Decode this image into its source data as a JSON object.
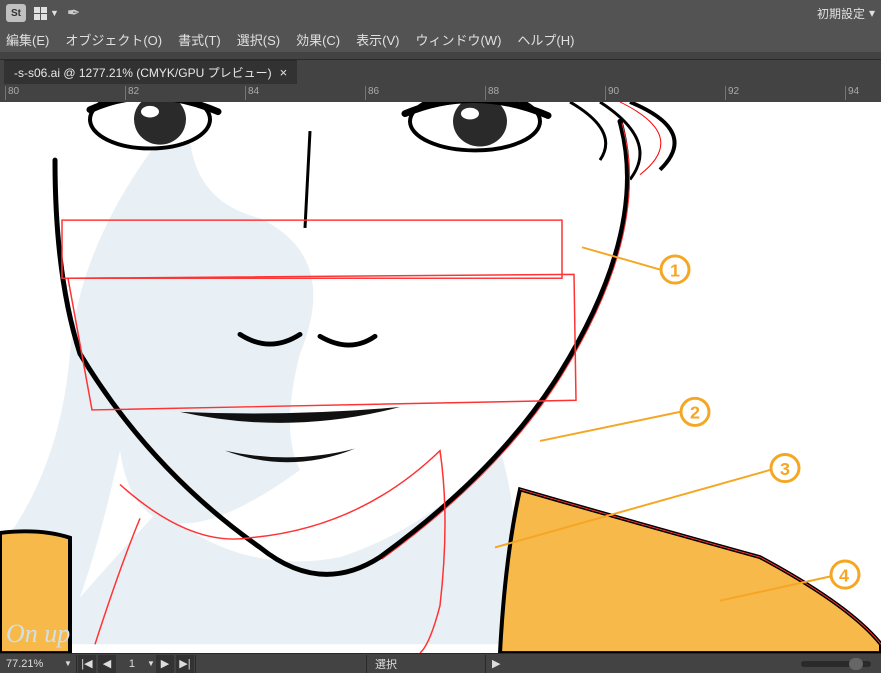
{
  "appbar": {
    "stock_badge": "St",
    "workspace_label": "初期設定",
    "workspace_caret": "▾"
  },
  "menu": {
    "items": [
      "編集(E)",
      "オブジェクト(O)",
      "書式(T)",
      "選択(S)",
      "効果(C)",
      "表示(V)",
      "ウィンドウ(W)",
      "ヘルプ(H)"
    ]
  },
  "tab": {
    "label": "-s-s06.ai @ 1277.21% (CMYK/GPU プレビュー)",
    "close": "×"
  },
  "ruler": {
    "ticks": [
      "80",
      "82",
      "84",
      "86",
      "88",
      "90",
      "92",
      "94"
    ]
  },
  "status": {
    "zoom": "77.21%",
    "nav_prev_fast": "◀◀",
    "nav_prev": "◀",
    "artboard_no": "1",
    "nav_next": "▶",
    "nav_next_fast": "▶▶",
    "tool": "選択",
    "play": "▶"
  },
  "watermark": "On up",
  "annotations": {
    "n1": "1",
    "n2": "2",
    "n3": "3",
    "n4": "4"
  }
}
